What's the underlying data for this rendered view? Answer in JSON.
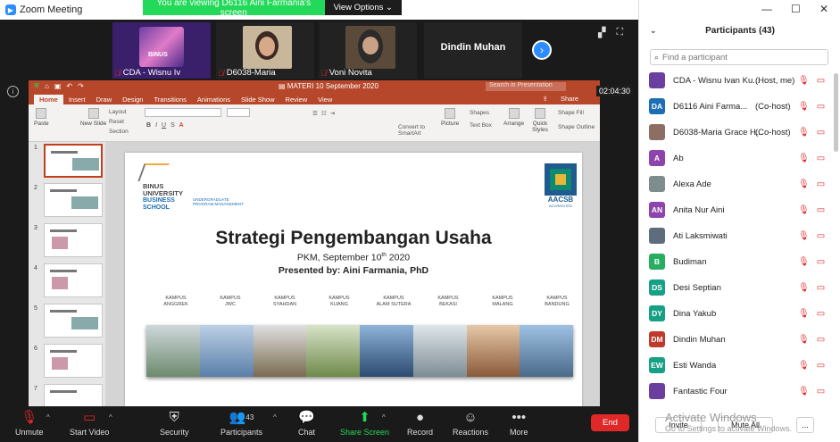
{
  "window": {
    "title": "Zoom Meeting"
  },
  "share_banner": {
    "text": "You are viewing D6116 Aini Farmania's screen",
    "view_options": "View Options"
  },
  "video_strip": {
    "tiles": [
      {
        "name": "CDA - Wisnu Iv"
      },
      {
        "name": "D6038-Maria"
      },
      {
        "name": "Voni Novita"
      },
      {
        "name": "Dindin Muhan"
      }
    ],
    "binus_tile_text": "BINUS"
  },
  "timer": "02:04:30",
  "ppt": {
    "doc_title": "MATERI 10 September 2020",
    "search_placeholder": "Search in Presentation",
    "share": "Share",
    "tabs": [
      "Home",
      "Insert",
      "Draw",
      "Design",
      "Transitions",
      "Animations",
      "Slide Show",
      "Review",
      "View"
    ],
    "ribbon": {
      "paste": "Paste",
      "new_slide": "New Slide",
      "layout": "Layout",
      "reset": "Reset",
      "section": "Section",
      "convert": "Convert to SmartArt",
      "picture": "Picture",
      "shapes": "Shapes",
      "text_box": "Text Box",
      "arrange": "Arrange",
      "quick_styles": "Quick Styles",
      "shape_fill": "Shape Fill",
      "shape_outline": "Shape Outline"
    },
    "slide_numbers": [
      "1",
      "2",
      "3",
      "4",
      "5",
      "6",
      "7"
    ],
    "slide": {
      "binus_univ": "BINUS UNIVERSITY",
      "binus_school": "BUSINESS SCHOOL",
      "program": "UNDERGRADUATE PROGRAM MANAGEMENT",
      "aacsb": "AACSB",
      "accredited": "ACCREDITED",
      "title": "Strategi Pengembangan Usaha",
      "subtitle_pre": "PKM, September 10",
      "subtitle_sup": "th",
      "subtitle_post": " 2020",
      "presenter": "Presented by: Aini Farmania, PhD",
      "campuses": [
        {
          "top": "KAMPUS",
          "bottom": "ANGGREK"
        },
        {
          "top": "KAMPUS",
          "bottom": "JWC"
        },
        {
          "top": "KAMPUS",
          "bottom": "SYAHDAN"
        },
        {
          "top": "KAMPUS",
          "bottom": "KIJANG"
        },
        {
          "top": "KAMPUS",
          "bottom": "ALAM SUTERA"
        },
        {
          "top": "KAMPUS",
          "bottom": "BEKASI"
        },
        {
          "top": "KAMPUS",
          "bottom": "MALANG"
        },
        {
          "top": "KAMPUS",
          "bottom": "BANDUNG"
        }
      ]
    }
  },
  "toolbar": {
    "unmute": "Unmute",
    "start_video": "Start Video",
    "security": "Security",
    "participants": "Participants",
    "participants_count": "43",
    "chat": "Chat",
    "share_screen": "Share Screen",
    "record": "Record",
    "reactions": "Reactions",
    "more": "More",
    "end": "End"
  },
  "participants_panel": {
    "title": "Participants (43)",
    "search_placeholder": "Find a participant",
    "invite": "Invite",
    "mute_all": "Mute All",
    "more": "...",
    "list": [
      {
        "initials": "",
        "name": "CDA - Wisnu Ivan Ku...",
        "tag": "(Host, me)",
        "color": "#6b3fa0"
      },
      {
        "initials": "DA",
        "name": "D6116 Aini Farma...",
        "tag": "(Co-host)",
        "color": "#1d6fb5"
      },
      {
        "initials": "",
        "name": "D6038-Maria Grace H...",
        "tag": "(Co-host)",
        "color": "#8d6e63"
      },
      {
        "initials": "A",
        "name": "Ab",
        "tag": "",
        "color": "#8e44ad"
      },
      {
        "initials": "",
        "name": "Alexa Ade",
        "tag": "",
        "color": "#7f8c8d"
      },
      {
        "initials": "AN",
        "name": "Anita Nur Aini",
        "tag": "",
        "color": "#8e44ad"
      },
      {
        "initials": "",
        "name": "Ati Laksmiwati",
        "tag": "",
        "color": "#5d6d7e"
      },
      {
        "initials": "B",
        "name": "Budiman",
        "tag": "",
        "color": "#27ae60"
      },
      {
        "initials": "DS",
        "name": "Desi Septian",
        "tag": "",
        "color": "#16a085"
      },
      {
        "initials": "DY",
        "name": "Dina Yakub",
        "tag": "",
        "color": "#16a085"
      },
      {
        "initials": "DM",
        "name": "Dindin Muhan",
        "tag": "",
        "color": "#c0392b"
      },
      {
        "initials": "EW",
        "name": "Esti Wanda",
        "tag": "",
        "color": "#16a085"
      },
      {
        "initials": "",
        "name": "Fantastic Four",
        "tag": "",
        "color": "#6b3fa0"
      }
    ]
  },
  "watermark": {
    "line1": "Activate Windows",
    "line2": "Go to Settings to activate Windows."
  },
  "colors": {
    "zoom_blue": "#2d8cff",
    "banner_green": "#23d959",
    "end_red": "#e02828",
    "ppt_orange": "#b7472a"
  }
}
